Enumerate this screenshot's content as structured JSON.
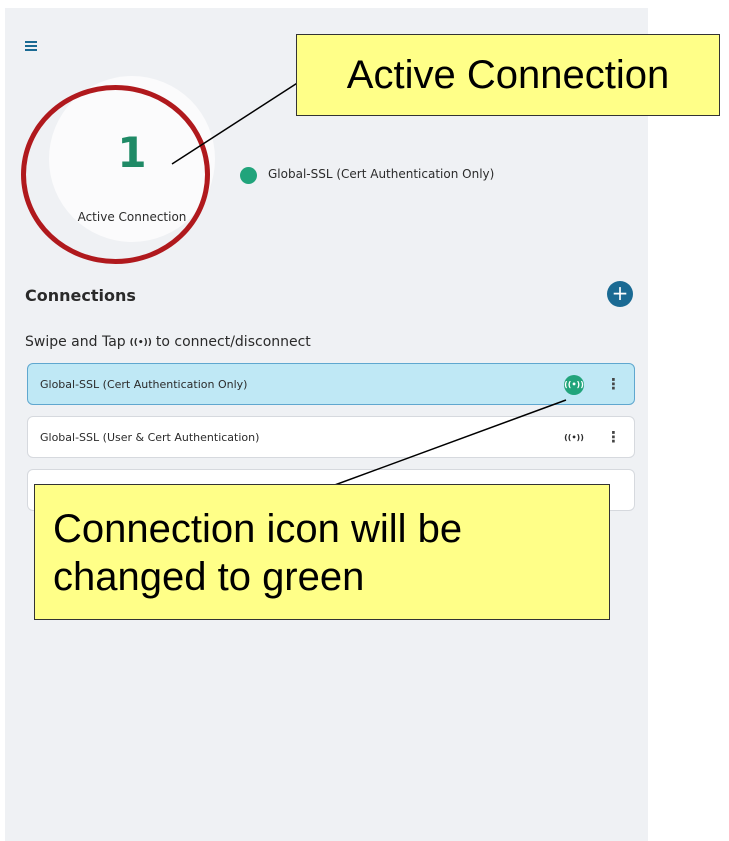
{
  "summary": {
    "active_count": "1",
    "label": "Active Connection",
    "active_connection_name": "Global-SSL (Cert Authentication Only)"
  },
  "connections_section": {
    "title": "Connections",
    "add_button_label": "+",
    "hint_before": "Swipe and Tap",
    "hint_icon": "((•))",
    "hint_after": "to connect/disconnect"
  },
  "connections": [
    {
      "name": "Global-SSL (Cert Authentication Only)",
      "connect_icon": "((•))",
      "state": "connected",
      "menu": "⋮"
    },
    {
      "name": "Global-SSL (User & Cert Authentication)",
      "connect_icon": "((•))",
      "state": "disconnected",
      "menu": "⋮"
    },
    {
      "name": "",
      "connect_icon": "",
      "state": "hidden",
      "menu": ""
    }
  ],
  "annotations": {
    "top_callout": "Active Connection",
    "bottom_callout_line1": "Connection icon will be",
    "bottom_callout_line2": "changed to green"
  },
  "colors": {
    "accent": "#1a6a93",
    "connected_green": "#21a47b",
    "active_row_bg": "#bfe8f5",
    "highlight_red": "#b0191d",
    "callout_yellow": "#ffff88"
  },
  "icons": {
    "menu": "hamburger-icon",
    "connect": "broadcast-icon",
    "more": "kebab-icon",
    "add": "plus-icon"
  }
}
